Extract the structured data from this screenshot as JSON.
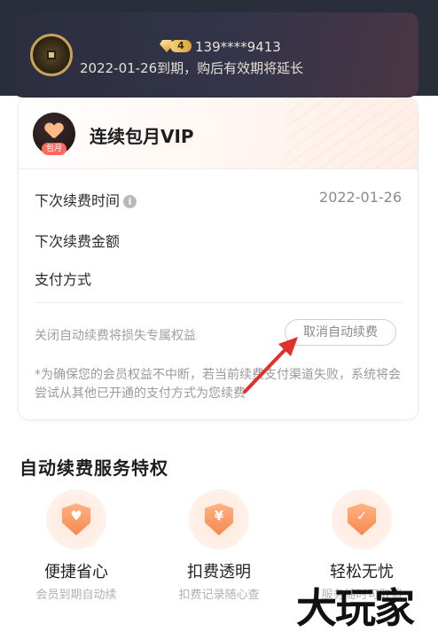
{
  "header": {
    "level": "4",
    "phone": "139****9413",
    "expiry_text": "2022-01-26到期，购后有效期将延长"
  },
  "package": {
    "title": "连续包月VIP",
    "tag": "包月"
  },
  "details": {
    "next_renew_time_label": "下次续费时间",
    "next_renew_time_value": "2022-01-26",
    "next_renew_amount_label": "下次续费金额",
    "payment_method_label": "支付方式"
  },
  "cancel": {
    "loss_text": "关闭自动续费将损失专属权益",
    "button_label": "取消自动续费"
  },
  "notice": "*为确保您的会员权益不中断，若当前续费支付渠道失败，系统将会尝试从其他已开通的支付方式为您续费",
  "privileges": {
    "section_title": "自动续费服务特权",
    "items": [
      {
        "title": "便捷省心",
        "subtitle": "会员到期自动续",
        "icon": "heart-shield-icon"
      },
      {
        "title": "扣费透明",
        "subtitle": "扣费记录随心查",
        "icon": "yen-shield-icon"
      },
      {
        "title": "轻松无忧",
        "subtitle": "服务随时可取消",
        "icon": "check-shield-icon"
      }
    ]
  },
  "watermark": "大玩家",
  "colors": {
    "accent_orange": "#f7884f",
    "arrow_red": "#e0302a",
    "dark_card": "#2b2e3d"
  }
}
